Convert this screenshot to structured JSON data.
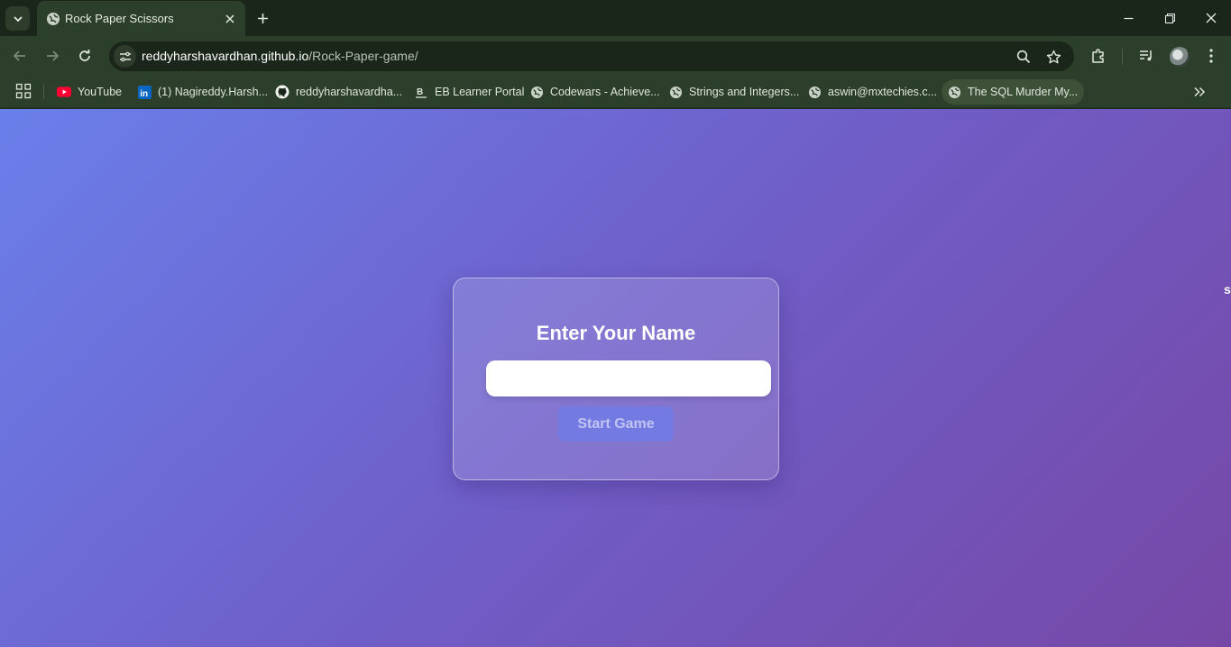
{
  "browser": {
    "tab": {
      "title": "Rock Paper Scissors"
    },
    "address_bar": {
      "host": "reddyharshavardhan.github.io",
      "path": "/Rock-Paper-game/"
    },
    "bookmarks": [
      {
        "label": "YouTube",
        "icon": "youtube-icon"
      },
      {
        "label": "(1) Nagireddy.Harsh...",
        "icon": "linkedin-icon"
      },
      {
        "label": "reddyharshavardha...",
        "icon": "github-icon"
      },
      {
        "label": "EB Learner Portal",
        "icon": "eb-icon"
      },
      {
        "label": "Codewars - Achieve...",
        "icon": "globe-icon"
      },
      {
        "label": "Strings and Integers...",
        "icon": "globe-icon"
      },
      {
        "label": "aswin@mxtechies.c...",
        "icon": "globe-icon"
      },
      {
        "label": "The SQL Murder My...",
        "icon": "globe-icon"
      }
    ]
  },
  "page": {
    "card": {
      "title": "Enter Your Name",
      "name_input_value": "",
      "start_button_label": "Start Game"
    },
    "edge_text": "s"
  },
  "colors": {
    "gradient_start": "#6a7fea",
    "gradient_end": "#7648a6",
    "browser_frame": "#2c3f2a"
  }
}
